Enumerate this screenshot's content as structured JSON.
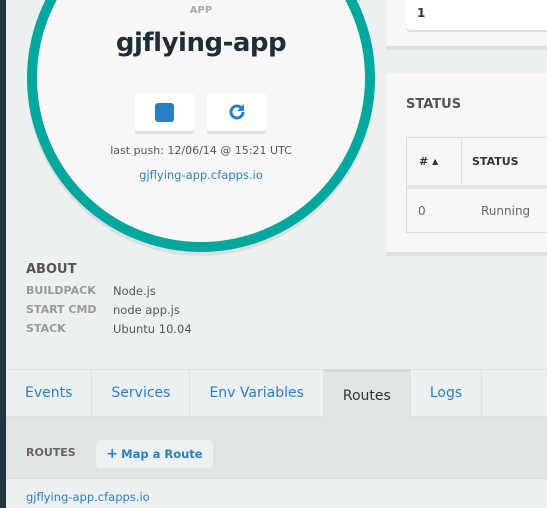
{
  "app": {
    "label": "APP",
    "name": "gjflying-app",
    "last_push": "last push: 12/06/14 @ 15:21 UTC",
    "url": "gjflying-app.cfapps.io"
  },
  "instances": {
    "value": "1"
  },
  "status": {
    "title": "STATUS",
    "columns": [
      "#",
      "STATUS"
    ],
    "rows": [
      {
        "index": "0",
        "status": "Running"
      }
    ]
  },
  "about": {
    "title": "ABOUT",
    "items": [
      {
        "key": "BUILDPACK",
        "value": "Node.js"
      },
      {
        "key": "START CMD",
        "value": "node app.js"
      },
      {
        "key": "STACK",
        "value": "Ubuntu 10.04"
      }
    ]
  },
  "tabs": [
    {
      "label": "Events"
    },
    {
      "label": "Services"
    },
    {
      "label": "Env Variables"
    },
    {
      "label": "Routes",
      "active": true
    },
    {
      "label": "Logs"
    }
  ],
  "routes": {
    "title": "ROUTES",
    "map_button": "Map a Route",
    "items": [
      "gjflying-app.cfapps.io"
    ]
  },
  "colors": {
    "accent": "#00a79d",
    "link": "#2a7ec4",
    "sidebar": "#22343f"
  }
}
